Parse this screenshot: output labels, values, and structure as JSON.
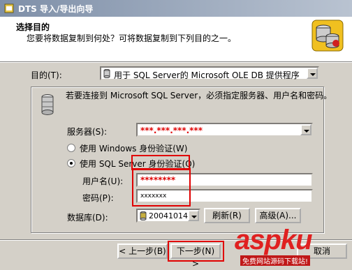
{
  "window": {
    "title": "DTS 导入/导出向导"
  },
  "header": {
    "title": "选择目的",
    "subtitle": "您要将数据复制到何处？可将数据复制到下列目的之一。"
  },
  "destination": {
    "label": "目的(T):",
    "value": "用于 SQL Server的 Microsoft OLE DB 提供程序"
  },
  "connection": {
    "instruction": "若要连接到 Microsoft SQL Server，必须指定服务器、用户名和密码。",
    "server_label": "服务器(S):",
    "server_value": "***.***.***.***",
    "windows_auth_label": "使用 Windows 身份验证(W)",
    "sql_auth_label": "使用 SQL Server 身份验证(Q)",
    "selected_auth": "sql",
    "username_label": "用户名(U):",
    "username_value": "********",
    "password_label": "密码(P):",
    "password_value": "xxxxxxx",
    "database_label": "数据库(D):",
    "database_value": "20041014(",
    "refresh_label": "刷新(R)",
    "advanced_label": "高级(A)..."
  },
  "footer": {
    "back_label": "< 上一步(B)",
    "next_label": "下一步(N) >",
    "cancel_label": "取消"
  },
  "watermark": {
    "text": "aspku",
    "subtext": "免费网站源码下载站!"
  },
  "colors": {
    "highlight": "#e00000",
    "dialog": "#d4d0c8"
  }
}
